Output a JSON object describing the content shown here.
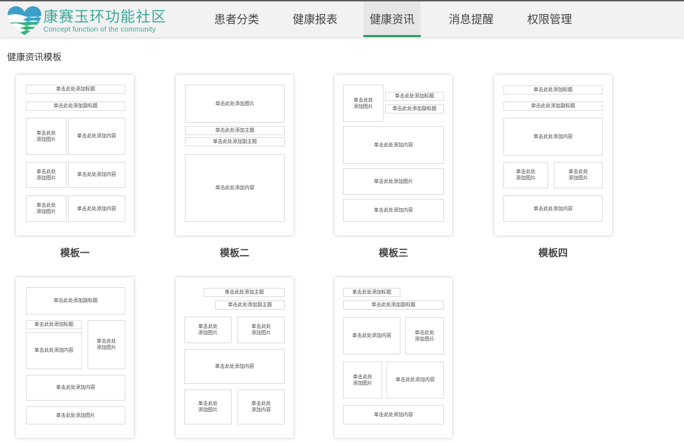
{
  "header": {
    "logo_title": "康赛玉环功能社区",
    "logo_subtitle": "Concept function of the community",
    "nav": [
      "患者分类",
      "健康报表",
      "健康资讯",
      "消息提醒",
      "权限管理"
    ],
    "active_tab": "健康资讯"
  },
  "page_title": "健康资讯模板",
  "labels": {
    "title": "单击此处添加标题",
    "subtitle": "单击此处添加副标题",
    "image": "单击此处添加图片",
    "content": "单击此处添加内容",
    "main_title": "单击此处添加主题",
    "sub_main_title": "单击此处添加副主题",
    "image_wrapped": "单击此处\n添加图片",
    "content_wrapped": "单击此处\n添加内容"
  },
  "templates": [
    {
      "name": "模板一"
    },
    {
      "name": "模板二"
    },
    {
      "name": "模板三"
    },
    {
      "name": "模板四"
    },
    {
      "name": ""
    },
    {
      "name": ""
    },
    {
      "name": ""
    }
  ]
}
